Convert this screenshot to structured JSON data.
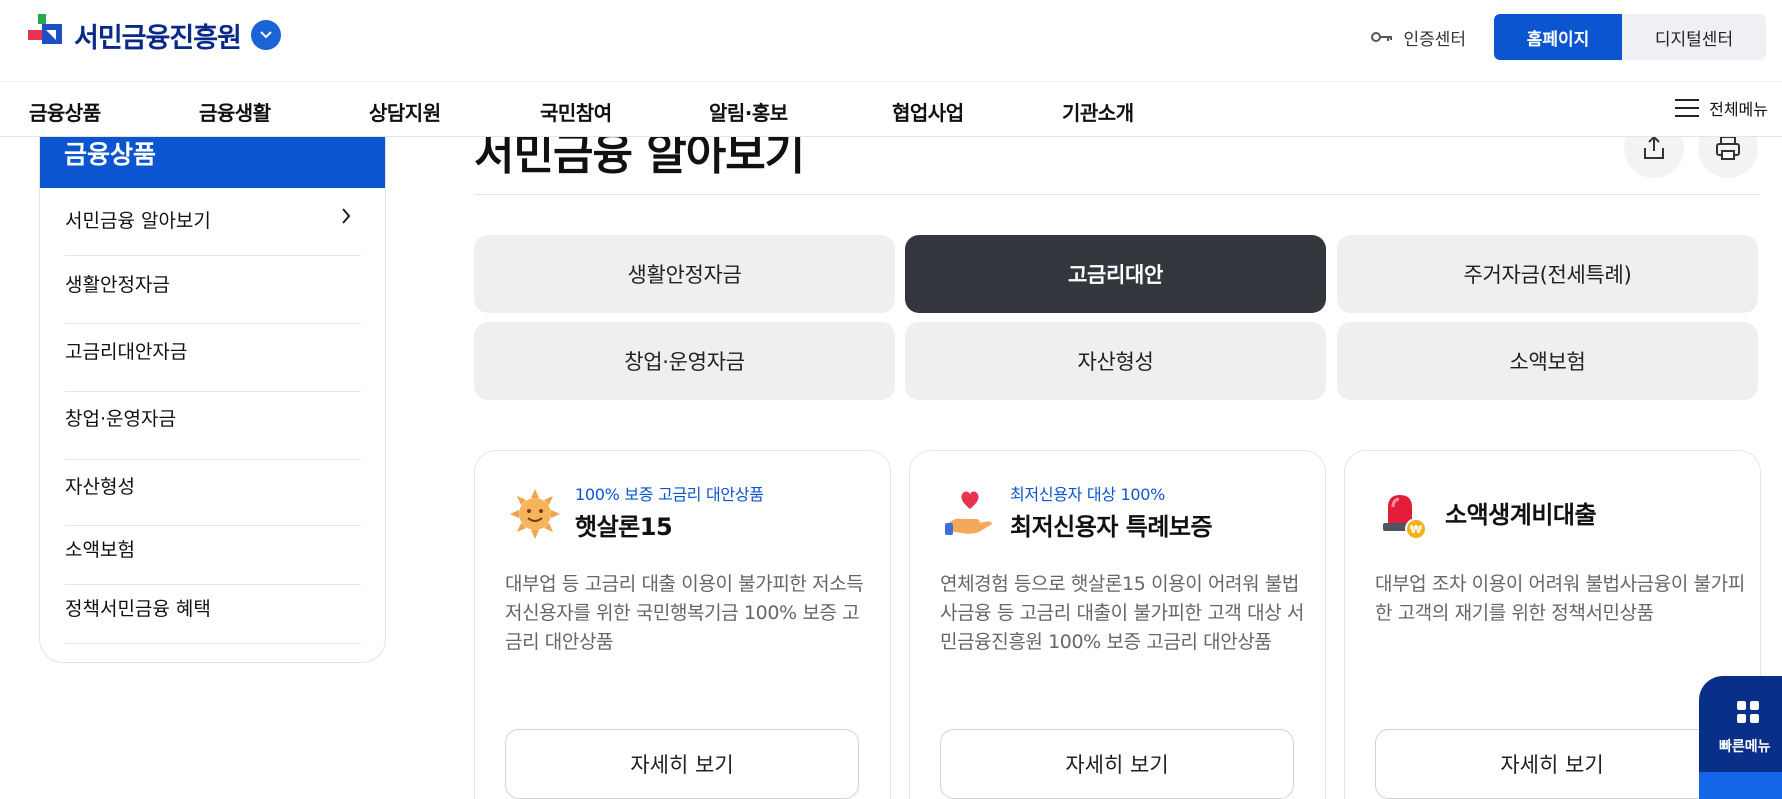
{
  "header": {
    "logo_text": "서민금융진흥원",
    "cert_center": "인증센터",
    "homepage": "홈페이지",
    "digital_center": "디지털센터"
  },
  "gnb": {
    "items": [
      "금융상품",
      "금융생활",
      "상담지원",
      "국민참여",
      "알림·홍보",
      "협업사업",
      "기관소개"
    ],
    "all_menu": "전체메뉴"
  },
  "sidebar": {
    "title": "금융상품",
    "items": [
      "서민금융 알아보기",
      "생활안정자금",
      "고금리대안자금",
      "창업·운영자금",
      "자산형성",
      "소액보험",
      "정책서민금융 혜택"
    ]
  },
  "main": {
    "title": "서민금융 알아보기",
    "tabs": [
      "생활안정자금",
      "고금리대안",
      "주거자금(전세특례)",
      "창업·운영자금",
      "자산형성",
      "소액보험"
    ],
    "active_tab": "고금리대안",
    "cards": [
      {
        "icon": "sun-icon",
        "subtitle": "100% 보증 고금리 대안상품",
        "name": "햇살론15",
        "desc": "대부업 등 고금리 대출 이용이 불가피한 저소득 저신용자를 위한 국민행복기금 100% 보증 고금리 대안상품",
        "button": "자세히 보기"
      },
      {
        "icon": "heart-hand-icon",
        "subtitle": "최저신용자 대상 100%",
        "name": "최저신용자 특례보증",
        "desc": "연체경험 등으로 햇살론15 이용이 어려워 불법사금융 등 고금리 대출이 불가피한 고객 대상 서민금융진흥원 100% 보증 고금리 대안상품",
        "button": "자세히 보기"
      },
      {
        "icon": "siren-icon",
        "subtitle": "",
        "name": "소액생계비대출",
        "desc": "대부업 조차 이용이 어려워 불법사금융이 불가피한 고객의 재기를 위한 정책서민상품",
        "button": "자세히 보기"
      }
    ]
  },
  "quick_menu": {
    "label": "빠른메뉴"
  },
  "colors": {
    "primary": "#0b56d0",
    "navy": "#0a2f88",
    "active_tab": "#33373d"
  }
}
